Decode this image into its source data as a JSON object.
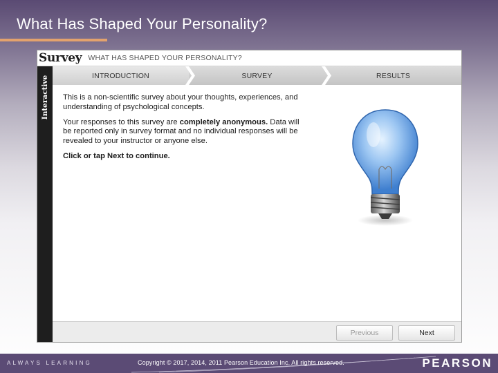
{
  "slide": {
    "title": "What Has Shaped Your Personality?"
  },
  "survey": {
    "logo": "Survey",
    "subtitle": "WHAT HAS SHAPED YOUR PERSONALITY?",
    "side_label": "Interactive",
    "steps": [
      {
        "label": "INTRODUCTION",
        "active": true
      },
      {
        "label": "SURVEY",
        "active": false
      },
      {
        "label": "RESULTS",
        "active": false
      }
    ],
    "paragraph1": "This is a non-scientific survey about your thoughts, experiences, and understanding of psychological concepts.",
    "paragraph2_prefix": "Your responses to this survey are ",
    "paragraph2_bold": "completely anonymous.",
    "paragraph2_suffix": " Data will be reported only in survey format and no individual responses will be revealed to your instructor or anyone else.",
    "paragraph3": "Click or tap Next to continue.",
    "image_icon": "light-bulb-icon",
    "buttons": {
      "previous": "Previous",
      "next": "Next"
    }
  },
  "footer": {
    "tagline": "ALWAYS LEARNING",
    "copyright": "Copyright © 2017, 2014, 2011 Pearson Education Inc. All rights reserved.",
    "brand": "PEARSON"
  },
  "colors": {
    "footer_bar": "#5b4b75",
    "title_rule": "#e3a26d",
    "side_strip": "#1e1e1e"
  }
}
